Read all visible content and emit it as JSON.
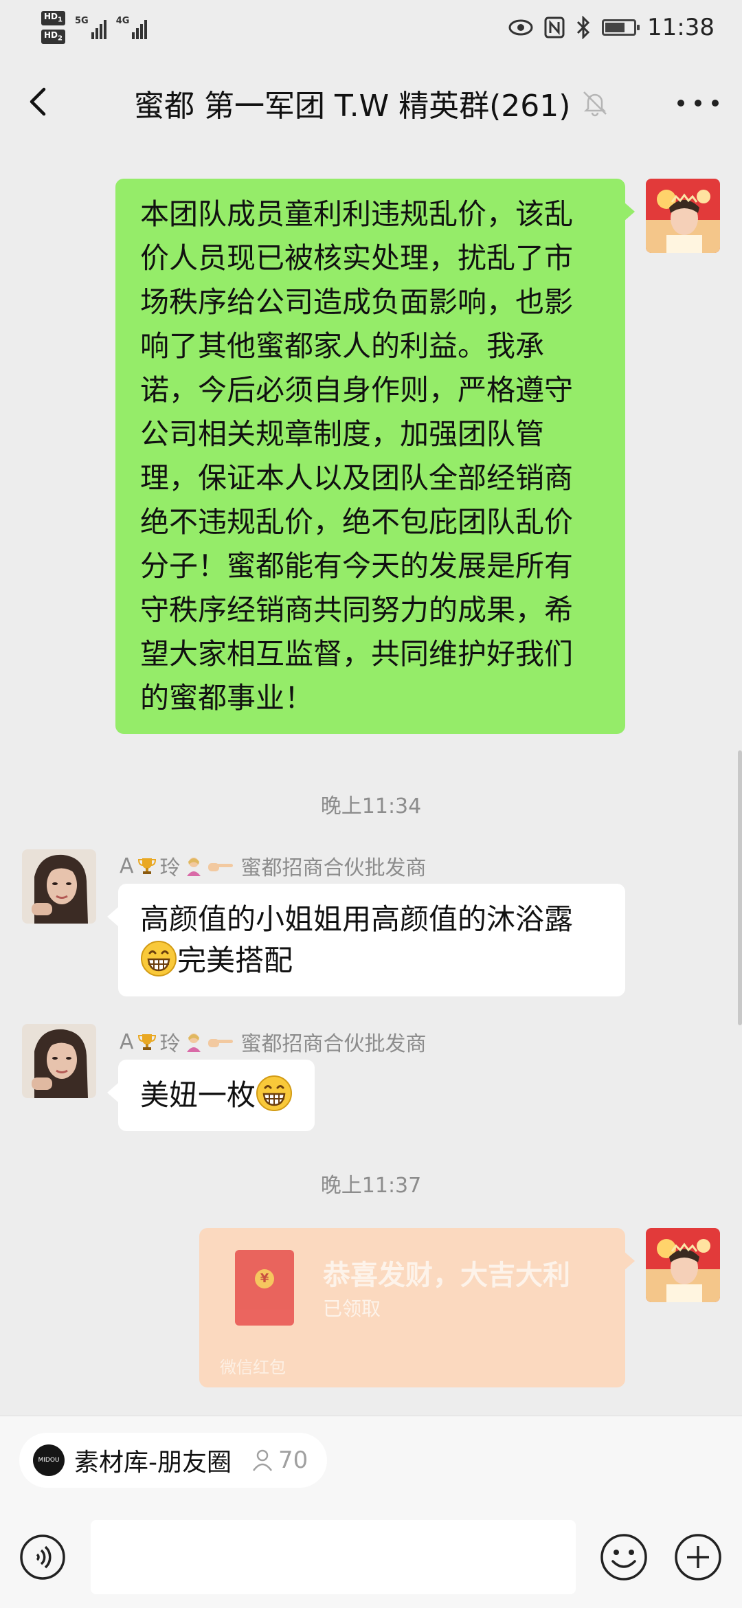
{
  "status_bar": {
    "hd1": "HD",
    "hd1_index": "1",
    "hd2": "HD",
    "hd2_index": "2",
    "net1": "5G",
    "net2": "4G",
    "time": "11:38",
    "battery_level": 0.7,
    "icons": [
      "eye-icon",
      "nfc-icon",
      "bluetooth-icon",
      "battery-icon"
    ]
  },
  "header": {
    "title": "蜜都 第一军团 T.W 精英群(261)",
    "back_icon": "chevron-left-icon",
    "mute_icon": "bell-off-icon",
    "more_icon": "more-icon"
  },
  "messages": [
    {
      "type": "text",
      "side": "self",
      "lines": [
        "本团队成员童利利违规乱价，该乱",
        "价人员现已被核实处理，扰乱了市",
        "场秩序给公司造成负面影响，也影",
        "响了其他蜜都家人的利益。我承",
        "诺，今后必须自身作则，严格遵守",
        "公司相关规章制度，加强团队管",
        "理，保证本人以及团队全部经销商",
        "绝不违规乱价，绝不包庇团队乱价",
        "分子！蜜都能有今天的发展是所有",
        "守秩序经销商共同努力的成果，希",
        "望大家相互监督，共同维护好我们",
        "的蜜都事业！"
      ]
    },
    {
      "type": "time",
      "text": "晚上11:34"
    },
    {
      "type": "text",
      "side": "other",
      "sender_prefix": "A",
      "sender_name": "玲",
      "sender_suffix": "蜜都招商合伙批发商",
      "line1": "高颜值的小姐姐用高颜值的沐浴露",
      "line2": "完美搭配"
    },
    {
      "type": "text",
      "side": "other",
      "sender_prefix": "A",
      "sender_name": "玲",
      "sender_suffix": "蜜都招商合伙批发商",
      "line1": "美妞一枚"
    },
    {
      "type": "time",
      "text": "晚上11:37"
    },
    {
      "type": "red_packet",
      "side": "self",
      "title": "恭喜发财，大吉大利",
      "status": "已领取",
      "footer": "微信红包",
      "coin": "¥"
    }
  ],
  "quick_bar": {
    "logo_text": "MIDOU",
    "label": "素材库-朋友圈",
    "count": "70"
  },
  "input_bar": {
    "placeholder": "",
    "voice_icon": "voice-icon",
    "emoji_icon": "emoji-icon",
    "plus_icon": "plus-icon"
  }
}
